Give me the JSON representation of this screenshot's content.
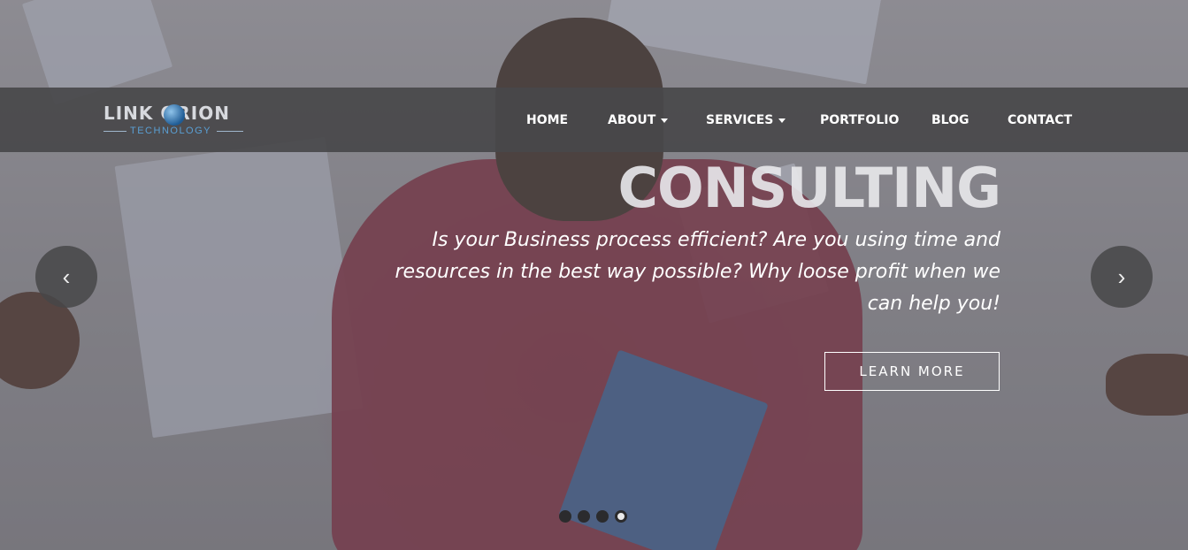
{
  "logo": {
    "main": "LINK ORION",
    "sub": "TECHNOLOGY"
  },
  "nav": {
    "home": "HOME",
    "about": "ABOUT",
    "services": "SERVICES",
    "portfolio": "PORTFOLIO",
    "blog": "BLOG",
    "contact": "CONTACT"
  },
  "slide": {
    "title": "CONSULTING",
    "text_line1": "Is your Business process efficient? Are you using time and",
    "text_line2": "resources in the best way possible? Why loose profit when we",
    "text_line3": "can help you!",
    "cta": "LEARN MORE"
  },
  "carousel": {
    "prev": "‹",
    "next": "›",
    "slide_count": 4,
    "active_slide": 4
  },
  "colors": {
    "navbar": "#48484a",
    "accent_blue": "#5a9fd4"
  }
}
